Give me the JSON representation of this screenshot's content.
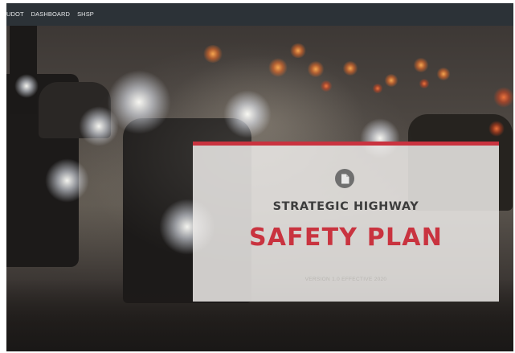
{
  "navbar": {
    "items": [
      {
        "label": "UDOT"
      },
      {
        "label": "DASHBOARD"
      },
      {
        "label": "SHSP"
      }
    ]
  },
  "hero": {
    "image": "foggy-night-traffic-photo"
  },
  "card": {
    "icon": "document-icon",
    "subtitle": "STRATEGIC HIGHWAY",
    "title": "SAFETY PLAN",
    "version": "VERSION 1.0 EFFECTIVE 2020",
    "accent_color": "#c9333f"
  }
}
